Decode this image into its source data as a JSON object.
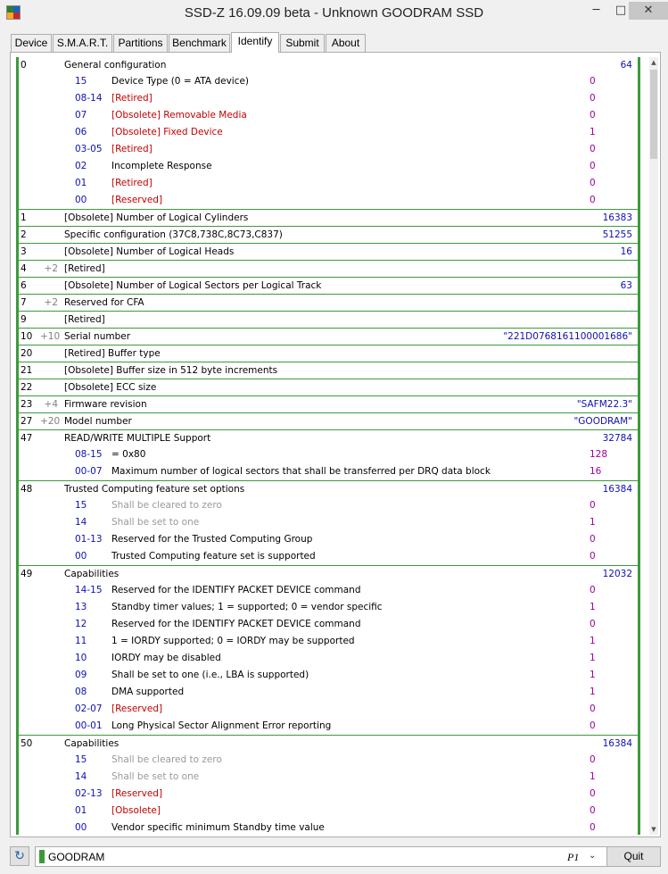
{
  "window": {
    "title": "SSD-Z 16.09.09 beta - Unknown GOODRAM SSD",
    "minimize": "─",
    "maximize": "□",
    "close": "✕"
  },
  "tabs": [
    {
      "label": "Device"
    },
    {
      "label": "S.M.A.R.T."
    },
    {
      "label": "Partitions"
    },
    {
      "label": "Benchmark"
    },
    {
      "label": "Identify",
      "active": true
    },
    {
      "label": "Submit"
    },
    {
      "label": "About"
    }
  ],
  "identify_rows": [
    {
      "word": "0",
      "count": "",
      "title": "General configuration",
      "value": "64",
      "subs": [
        {
          "bits": "15",
          "desc": "Device Type (0 = ATA device)",
          "val": "0",
          "style": "normal"
        },
        {
          "bits": "08-14",
          "desc": "[Retired]",
          "val": "0",
          "style": "red"
        },
        {
          "bits": "07",
          "desc": "[Obsolete] Removable Media",
          "val": "0",
          "style": "red"
        },
        {
          "bits": "06",
          "desc": "[Obsolete] Fixed Device",
          "val": "1",
          "style": "red"
        },
        {
          "bits": "03-05",
          "desc": "[Retired]",
          "val": "0",
          "style": "red"
        },
        {
          "bits": "02",
          "desc": "Incomplete Response",
          "val": "0",
          "style": "normal"
        },
        {
          "bits": "01",
          "desc": "[Retired]",
          "val": "0",
          "style": "red"
        },
        {
          "bits": "00",
          "desc": "[Reserved]",
          "val": "0",
          "style": "red"
        }
      ]
    },
    {
      "word": "1",
      "count": "",
      "title": "[Obsolete] Number of Logical Cylinders",
      "value": "16383",
      "subs": []
    },
    {
      "word": "2",
      "count": "",
      "title": "Specific configuration (37C8,738C,8C73,C837)",
      "value": "51255",
      "subs": []
    },
    {
      "word": "3",
      "count": "",
      "title": "[Obsolete] Number of Logical Heads",
      "value": "16",
      "subs": []
    },
    {
      "word": "4",
      "count": "+2",
      "title": "[Retired]",
      "value": "",
      "subs": []
    },
    {
      "word": "6",
      "count": "",
      "title": "[Obsolete] Number of Logical Sectors per Logical Track",
      "value": "63",
      "subs": []
    },
    {
      "word": "7",
      "count": "+2",
      "title": "Reserved for CFA",
      "value": "",
      "subs": []
    },
    {
      "word": "9",
      "count": "",
      "title": "[Retired]",
      "value": "",
      "subs": []
    },
    {
      "word": "10",
      "count": "+10",
      "title": "Serial number",
      "value": "\"221D0768161100001686\"",
      "subs": []
    },
    {
      "word": "20",
      "count": "",
      "title": "[Retired] Buffer type",
      "value": "",
      "subs": []
    },
    {
      "word": "21",
      "count": "",
      "title": "[Obsolete] Buffer size in 512 byte increments",
      "value": "",
      "subs": []
    },
    {
      "word": "22",
      "count": "",
      "title": "[Obsolete] ECC size",
      "value": "",
      "subs": []
    },
    {
      "word": "23",
      "count": "+4",
      "title": "Firmware revision",
      "value": "\"SAFM22.3\"",
      "subs": []
    },
    {
      "word": "27",
      "count": "+20",
      "title": "Model number",
      "value": "\"GOODRAM\"",
      "subs": []
    },
    {
      "word": "47",
      "count": "",
      "title": "READ/WRITE MULTIPLE Support",
      "value": "32784",
      "subs": [
        {
          "bits": "08-15",
          "desc": "= 0x80",
          "val": "128",
          "style": "normal"
        },
        {
          "bits": "00-07",
          "desc": "Maximum number of logical sectors that shall be transferred per DRQ data block",
          "val": "16",
          "style": "normal"
        }
      ]
    },
    {
      "word": "48",
      "count": "",
      "title": "Trusted Computing feature set options",
      "value": "16384",
      "subs": [
        {
          "bits": "15",
          "desc": "Shall be cleared to zero",
          "val": "0",
          "style": "gray"
        },
        {
          "bits": "14",
          "desc": "Shall be set to one",
          "val": "1",
          "style": "gray"
        },
        {
          "bits": "01-13",
          "desc": "Reserved for the Trusted Computing Group",
          "val": "0",
          "style": "normal"
        },
        {
          "bits": "00",
          "desc": "Trusted Computing feature set is supported",
          "val": "0",
          "style": "normal"
        }
      ]
    },
    {
      "word": "49",
      "count": "",
      "title": "Capabilities",
      "value": "12032",
      "subs": [
        {
          "bits": "14-15",
          "desc": "Reserved for the IDENTIFY PACKET DEVICE command",
          "val": "0",
          "style": "normal"
        },
        {
          "bits": "13",
          "desc": "Standby timer values; 1 = supported; 0 = vendor specific",
          "val": "1",
          "style": "normal"
        },
        {
          "bits": "12",
          "desc": "Reserved for the IDENTIFY PACKET DEVICE command",
          "val": "0",
          "style": "normal"
        },
        {
          "bits": "11",
          "desc": "1 = IORDY supported; 0 = IORDY may be supported",
          "val": "1",
          "style": "normal"
        },
        {
          "bits": "10",
          "desc": "IORDY may be disabled",
          "val": "1",
          "style": "normal"
        },
        {
          "bits": "09",
          "desc": "Shall be set to one (i.e., LBA is supported)",
          "val": "1",
          "style": "normal"
        },
        {
          "bits": "08",
          "desc": "DMA supported",
          "val": "1",
          "style": "normal"
        },
        {
          "bits": "02-07",
          "desc": "[Reserved]",
          "val": "0",
          "style": "red"
        },
        {
          "bits": "00-01",
          "desc": "Long Physical Sector Alignment Error reporting",
          "val": "0",
          "style": "normal"
        }
      ]
    },
    {
      "word": "50",
      "count": "",
      "title": "Capabilities",
      "value": "16384",
      "subs": [
        {
          "bits": "15",
          "desc": "Shall be cleared to zero",
          "val": "0",
          "style": "gray"
        },
        {
          "bits": "14",
          "desc": "Shall be set to one",
          "val": "1",
          "style": "gray"
        },
        {
          "bits": "02-13",
          "desc": "[Reserved]",
          "val": "0",
          "style": "red"
        },
        {
          "bits": "01",
          "desc": "[Obsolete]",
          "val": "0",
          "style": "red"
        },
        {
          "bits": "00",
          "desc": "Vendor specific minimum Standby time value",
          "val": "0",
          "style": "normal"
        }
      ]
    }
  ],
  "bottom": {
    "drive_name": "GOODRAM",
    "partition": "P1",
    "chevron": "⌄",
    "quit_label": "Quit",
    "refresh_icon": "↻"
  },
  "colors": {
    "accent_green": "#3c9a3c",
    "value_blue": "#1010b0",
    "value_purple": "#a000a0",
    "retired_red": "#c00000"
  }
}
